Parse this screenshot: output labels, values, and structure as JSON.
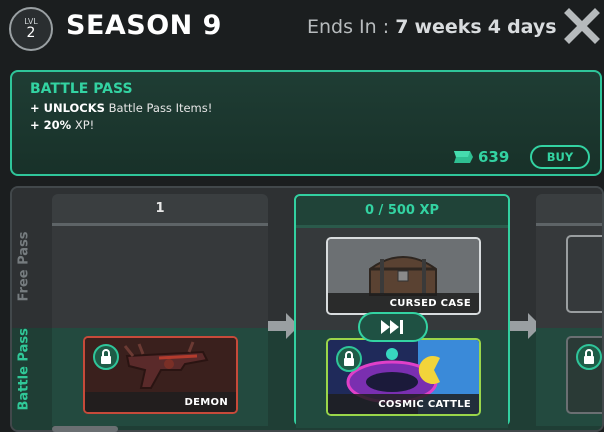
{
  "header": {
    "level_label": "LVL",
    "level_value": "2",
    "season_title": "SEASON 9",
    "ends_in_label": "Ends In :",
    "ends_in_weeks_num": "7",
    "ends_in_weeks_word": "weeks",
    "ends_in_days_num": "4",
    "ends_in_days_word": "days"
  },
  "banner": {
    "title": "BATTLE PASS",
    "line1_prefix": "+ UNLOCKS",
    "line1_rest": "Battle Pass Items!",
    "line2_prefix": "+ 20%",
    "line2_rest": "XP!",
    "price": "639",
    "buy_label": "BUY"
  },
  "track": {
    "free_label": "Free Pass",
    "bp_label": "Battle Pass",
    "tiers": [
      {
        "header": "1",
        "free_item": "",
        "bp_item": "DEMON",
        "bp_locked": true
      },
      {
        "header": "0 / 500 XP",
        "free_item": "CURSED CASE",
        "bp_item": "COSMIC CATTLE",
        "bp_locked": true
      }
    ]
  },
  "colors": {
    "accent": "#33d3a2",
    "background": "#1b1e1f",
    "banner_bg": "#1f3d34",
    "locked_frame": "#c64a3a"
  },
  "icons": [
    "close-icon",
    "gem-icon",
    "lock-icon",
    "arrow-right-icon",
    "skip-forward-icon"
  ]
}
